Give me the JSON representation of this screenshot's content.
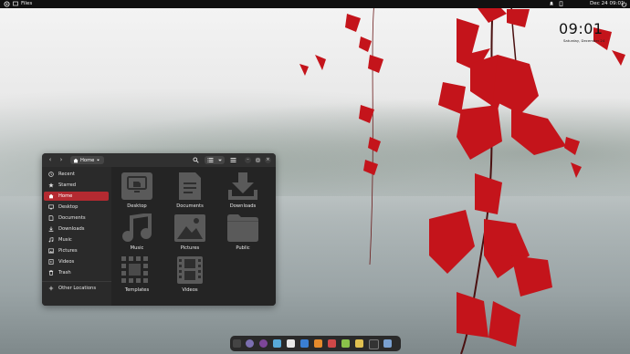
{
  "topbar": {
    "app_name": "Files",
    "clock": "Dec 24  09:01"
  },
  "desktop_clock": {
    "time": "09:01",
    "date": "Saturday, December 24"
  },
  "window": {
    "path": "Home",
    "sidebar": [
      {
        "label": "Recent",
        "icon": "clock-icon"
      },
      {
        "label": "Starred",
        "icon": "star-icon"
      },
      {
        "label": "Home",
        "icon": "home-icon",
        "active": true
      },
      {
        "label": "Desktop",
        "icon": "desktop-icon"
      },
      {
        "label": "Documents",
        "icon": "document-icon"
      },
      {
        "label": "Downloads",
        "icon": "download-icon"
      },
      {
        "label": "Music",
        "icon": "music-icon"
      },
      {
        "label": "Pictures",
        "icon": "picture-icon"
      },
      {
        "label": "Videos",
        "icon": "video-icon"
      },
      {
        "label": "Trash",
        "icon": "trash-icon"
      }
    ],
    "other_locations": "Other Locations",
    "folders": [
      {
        "label": "Desktop",
        "icon": "desktop-folder-icon"
      },
      {
        "label": "Documents",
        "icon": "documents-folder-icon"
      },
      {
        "label": "Downloads",
        "icon": "downloads-folder-icon"
      },
      {
        "label": "Music",
        "icon": "music-folder-icon"
      },
      {
        "label": "Pictures",
        "icon": "pictures-folder-icon"
      },
      {
        "label": "Public",
        "icon": "public-folder-icon"
      },
      {
        "label": "Templates",
        "icon": "templates-folder-icon"
      },
      {
        "label": "Videos",
        "icon": "videos-folder-icon"
      }
    ]
  },
  "colors": {
    "accent": "#b42a31",
    "window_bg": "#242424",
    "sidebar_bg": "#2a2a2a",
    "folder_icon": "#5a5a5a"
  },
  "dock": [
    {
      "name": "apps-grid-icon",
      "color": "#444444"
    },
    {
      "name": "browser-icon",
      "color": "#7b6fb0"
    },
    {
      "name": "tor-icon",
      "color": "#7d4698"
    },
    {
      "name": "mail-icon",
      "color": "#58a9d8"
    },
    {
      "name": "calendar-icon",
      "color": "#e8e8e8"
    },
    {
      "name": "docs-icon",
      "color": "#3a7fd4"
    },
    {
      "name": "office-icon",
      "color": "#e58a2c"
    },
    {
      "name": "software-icon",
      "color": "#d04848"
    },
    {
      "name": "notes-icon",
      "color": "#8ac24a"
    },
    {
      "name": "text-editor-icon",
      "color": "#e0c050"
    },
    {
      "name": "terminal-icon",
      "color": "#333333"
    },
    {
      "name": "settings-icon",
      "color": "#7aa0d0"
    }
  ]
}
